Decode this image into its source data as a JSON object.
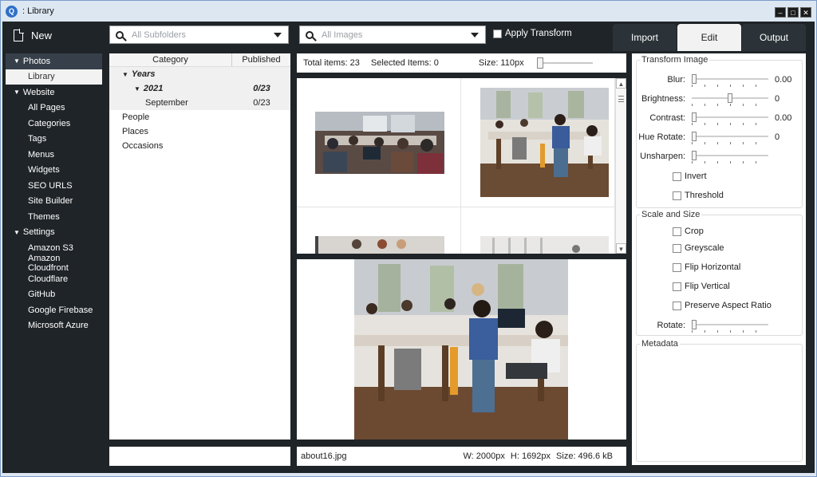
{
  "window": {
    "title": ": Library",
    "app_icon_glyph": "Q"
  },
  "toolbar": {
    "new_label": "New",
    "subfolders": {
      "placeholder": "All Subfolders"
    },
    "images": {
      "placeholder": "All Images"
    },
    "apply_transform_label": "Apply Transform",
    "apply_transform_checked": false,
    "tabs": [
      {
        "label": "Import",
        "active": false
      },
      {
        "label": "Edit",
        "active": true
      },
      {
        "label": "Output",
        "active": false
      }
    ]
  },
  "nav": {
    "groups": [
      {
        "label": "Photos",
        "items": [
          "Library"
        ]
      },
      {
        "label": "Website",
        "items": [
          "All Pages",
          "Categories",
          "Tags",
          "Menus",
          "Widgets",
          "SEO URLS",
          "Site Builder",
          "Themes"
        ]
      },
      {
        "label": "Settings",
        "items": [
          "Amazon S3",
          "Amazon Cloudfront",
          "Cloudflare",
          "GitHub",
          "Google Firebase",
          "Microsoft Azure"
        ]
      }
    ],
    "active_item": "Library"
  },
  "categories": {
    "columns": [
      "Category",
      "Published"
    ],
    "rows": [
      {
        "label": "Years",
        "value": "",
        "level": 0,
        "expanded": true,
        "style": "bold-italic"
      },
      {
        "label": "2021",
        "value": "0/23",
        "level": 1,
        "expanded": true,
        "style": "bold-italic"
      },
      {
        "label": "September",
        "value": "0/23",
        "level": 2,
        "style": "normal"
      },
      {
        "label": "People",
        "value": "",
        "level": 0,
        "style": "normal"
      },
      {
        "label": "Places",
        "value": "",
        "level": 0,
        "style": "normal"
      },
      {
        "label": "Occasions",
        "value": "",
        "level": 0,
        "style": "normal"
      }
    ]
  },
  "gallery": {
    "total_items": "Total items: 23",
    "selected_items": "Selected Items: 0",
    "size_label": "Size: 110px",
    "size_level": 0.0
  },
  "preview": {
    "filename": "about16.jpg",
    "width": "W: 2000px",
    "height": "H: 1692px",
    "size": "Size: 496.6 kB"
  },
  "transform": {
    "title": "Transform Image",
    "sliders": [
      {
        "label": "Blur:",
        "value": "0.00",
        "level": 0.0
      },
      {
        "label": "Brightness:",
        "value": "0",
        "level": 0.5
      },
      {
        "label": "Contrast:",
        "value": "0.00",
        "level": 0.0
      },
      {
        "label": "Hue Rotate:",
        "value": "0",
        "level": 0.0
      },
      {
        "label": "Unsharpen:",
        "value": "",
        "level": 0.0
      }
    ],
    "checkboxes": [
      "Invert",
      "Threshold"
    ]
  },
  "scale": {
    "title": "Scale and Size",
    "checkboxes": [
      "Crop",
      "Greyscale",
      "Flip Horizontal",
      "Flip Vertical",
      "Preserve Aspect Ratio"
    ],
    "rotate_label": "Rotate:",
    "rotate_level": 0.0
  },
  "metadata": {
    "title": "Metadata"
  },
  "colors": {
    "app_bg": "#1f2428",
    "panel_bg": "#ffffff",
    "active_tab_bg": "#f2f2f2",
    "nav_group_selected": "#37404a"
  }
}
